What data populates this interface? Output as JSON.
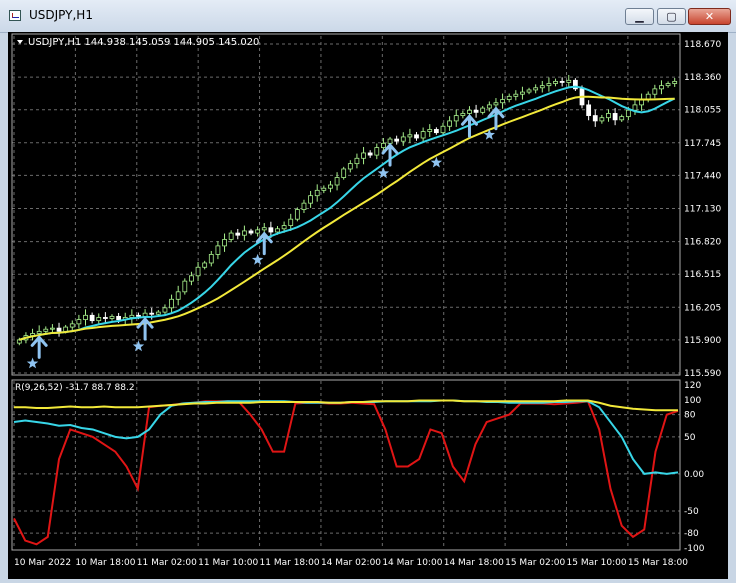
{
  "window": {
    "title": "USDJPY,H1",
    "minimize": "▁",
    "maximize": "▢",
    "close": "✕"
  },
  "chart_data": [
    {
      "type": "candlestick",
      "title": "USDJPY,H1  144.938 145.059 144.905 145.020",
      "ylim": [
        115.59,
        118.67
      ],
      "yticks": [
        "118.670",
        "118.360",
        "118.055",
        "117.745",
        "117.440",
        "117.130",
        "116.820",
        "116.515",
        "116.205",
        "115.900",
        "115.590"
      ],
      "xticks": [
        "10 Mar 2022",
        "10 Mar 18:00",
        "11 Mar 02:00",
        "11 Mar 10:00",
        "11 Mar 18:00",
        "14 Mar 02:00",
        "14 Mar 10:00",
        "14 Mar 18:00",
        "15 Mar 02:00",
        "15 Mar 10:00",
        "15 Mar 18:00"
      ],
      "close": [
        115.9,
        115.94,
        115.96,
        115.98,
        116.0,
        116.01,
        115.98,
        116.02,
        116.05,
        116.09,
        116.13,
        116.08,
        116.11,
        116.1,
        116.12,
        116.09,
        116.11,
        116.13,
        116.12,
        116.15,
        116.14,
        116.16,
        116.2,
        116.28,
        116.35,
        116.45,
        116.5,
        116.58,
        116.62,
        116.7,
        116.78,
        116.84,
        116.9,
        116.88,
        116.92,
        116.9,
        116.93,
        116.95,
        116.91,
        116.94,
        116.97,
        117.03,
        117.12,
        117.18,
        117.25,
        117.3,
        117.32,
        117.35,
        117.42,
        117.5,
        117.55,
        117.6,
        117.65,
        117.63,
        117.7,
        117.74,
        117.78,
        117.76,
        117.8,
        117.82,
        117.79,
        117.85,
        117.87,
        117.84,
        117.9,
        117.95,
        118.0,
        118.02,
        118.05,
        118.03,
        118.07,
        118.1,
        118.12,
        118.15,
        118.18,
        118.2,
        118.22,
        118.24,
        118.26,
        118.28,
        118.3,
        118.32,
        118.31,
        118.33,
        118.25,
        118.1,
        118.0,
        117.95,
        117.98,
        118.02,
        117.96,
        117.99,
        118.05,
        118.1,
        118.15,
        118.2,
        118.25,
        118.28,
        118.3,
        118.32
      ],
      "series": [
        {
          "name": "",
          "color": "#38d6e8"
        },
        {
          "name": "",
          "color": "#f2e93a"
        }
      ],
      "markers": [
        {
          "kind": "arrow",
          "index": 3
        },
        {
          "kind": "arrow",
          "index": 19
        },
        {
          "kind": "arrow",
          "index": 37
        },
        {
          "kind": "arrow",
          "index": 56
        },
        {
          "kind": "arrow",
          "index": 68
        },
        {
          "kind": "arrow",
          "index": 72
        },
        {
          "kind": "star",
          "index": 2
        },
        {
          "kind": "star",
          "index": 18
        },
        {
          "kind": "star",
          "index": 36
        },
        {
          "kind": "star",
          "index": 55
        },
        {
          "kind": "star",
          "index": 63
        },
        {
          "kind": "star",
          "index": 71
        }
      ],
      "colors": {
        "bull": "#a8f08c",
        "bear": "#ffffff",
        "grid": "#6b6b6b",
        "background": "#000000",
        "marker": "#8fc3f0"
      }
    },
    {
      "type": "line",
      "title": "R(9,26,52) -31.7 88.7 88.2",
      "ylim": [
        -100,
        120
      ],
      "yticks": [
        "120",
        "100",
        "80",
        "50",
        "0.00",
        "-50",
        "-80",
        "-100"
      ],
      "series": [
        {
          "name": "",
          "color": "#e01515",
          "values": [
            -60,
            -90,
            -95,
            -85,
            20,
            60,
            55,
            50,
            40,
            30,
            10,
            -20,
            90,
            92,
            93,
            95,
            96,
            98,
            98,
            98,
            97,
            80,
            60,
            30,
            30,
            95,
            96,
            96,
            95,
            95,
            96,
            95,
            94,
            60,
            10,
            10,
            20,
            60,
            55,
            10,
            -10,
            40,
            70,
            75,
            80,
            95,
            95,
            95,
            94,
            95,
            96,
            98,
            60,
            -20,
            -70,
            -85,
            -75,
            30,
            80,
            85
          ]
        },
        {
          "name": "",
          "color": "#38d6e8",
          "values": [
            70,
            72,
            70,
            68,
            65,
            66,
            62,
            60,
            55,
            50,
            48,
            50,
            60,
            80,
            92,
            95,
            96,
            97,
            97,
            98,
            98,
            98,
            98,
            98,
            98,
            97,
            96,
            96,
            96,
            96,
            97,
            97,
            97,
            98,
            98,
            98,
            98,
            98,
            99,
            99,
            98,
            98,
            97,
            97,
            96,
            96,
            96,
            96,
            97,
            97,
            98,
            98,
            90,
            70,
            50,
            20,
            0,
            2,
            0,
            2
          ]
        },
        {
          "name": "",
          "color": "#f2e93a",
          "values": [
            90,
            90,
            89,
            89,
            90,
            91,
            90,
            90,
            91,
            90,
            90,
            90,
            91,
            92,
            93,
            94,
            95,
            95,
            96,
            96,
            96,
            96,
            97,
            97,
            97,
            97,
            97,
            97,
            96,
            96,
            97,
            97,
            98,
            98,
            98,
            98,
            99,
            99,
            99,
            99,
            98,
            98,
            98,
            98,
            98,
            98,
            98,
            98,
            98,
            99,
            99,
            99,
            96,
            92,
            90,
            88,
            87,
            86,
            86,
            86
          ]
        }
      ]
    }
  ]
}
